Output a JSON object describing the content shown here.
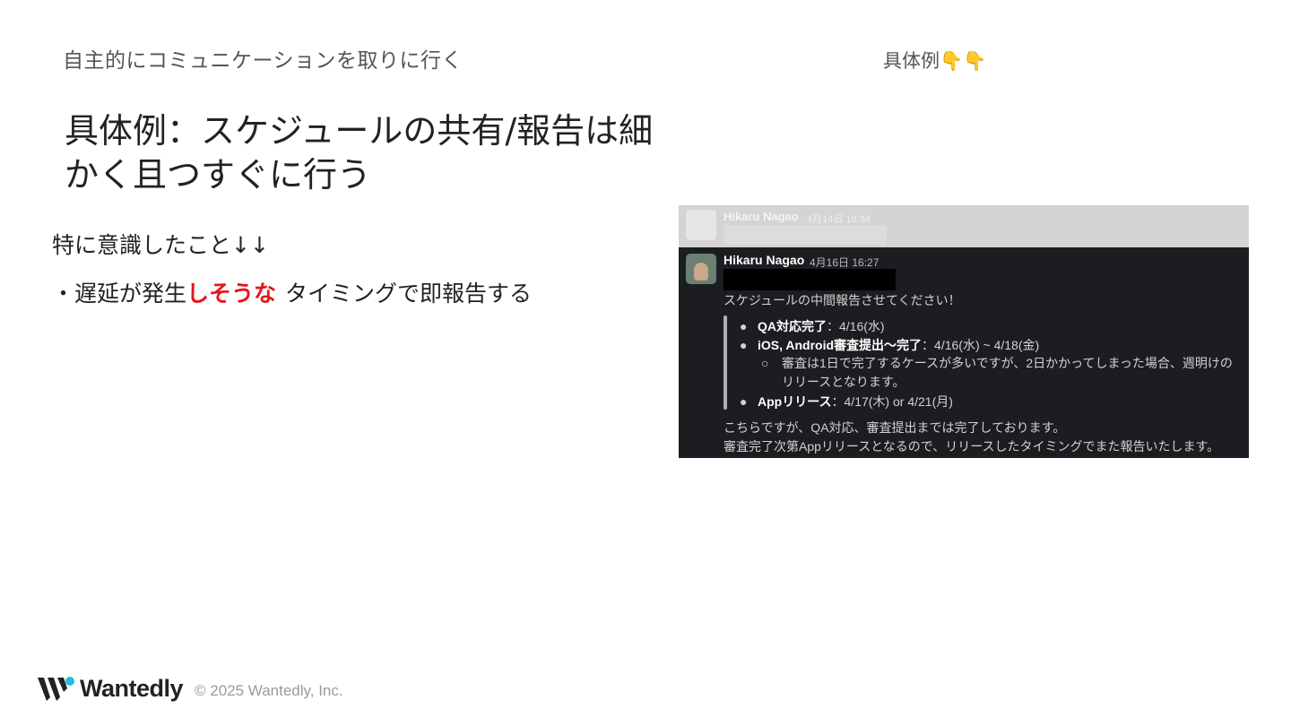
{
  "slide": {
    "section_label": "自主的にコミュニケーションを取りに行く",
    "example_label": "具体例👇👇",
    "title": "具体例：スケジュールの共有/報告は細かく且つすぐに行う",
    "subhead": "特に意識したこと↓↓",
    "bullet_marker": "・",
    "bullet_part1": "遅延が発生",
    "bullet_highlight": "しそうな",
    "bullet_part2": "タイミングで即報告する",
    "highlight_color": "#e8141c"
  },
  "slack": {
    "previous_message": {
      "author": "Hikaru Nagao",
      "time": "4月14日 18:34"
    },
    "message": {
      "author": "Hikaru Nagao",
      "time": "4月16日 16:27",
      "intro": "スケジュールの中間報告させてください！",
      "items": [
        {
          "bullet": "●",
          "label": "QA対応完了",
          "value": "：4/16(水)"
        },
        {
          "bullet": "●",
          "label": "iOS, Android審査提出〜完了",
          "value": "：4/16(水) ~ 4/18(金)"
        },
        {
          "bullet": "●",
          "label": "Appリリース",
          "value": "：4/17(木) or 4/21(月)"
        }
      ],
      "subitem": {
        "bullet": "○",
        "line1": "審査は1日で完了するケースが多いですが、2日かかってしまった場合、週明けの",
        "line2": "リリースとなります。"
      },
      "outro1": "こちらですが、QA対応、審査提出までは完了しております。",
      "outro2": "審査完了次第Appリリースとなるので、リリースしたタイミングでまた報告いたします。"
    }
  },
  "footer": {
    "brand": "Wantedly",
    "copyright": "© 2025 Wantedly, Inc."
  }
}
